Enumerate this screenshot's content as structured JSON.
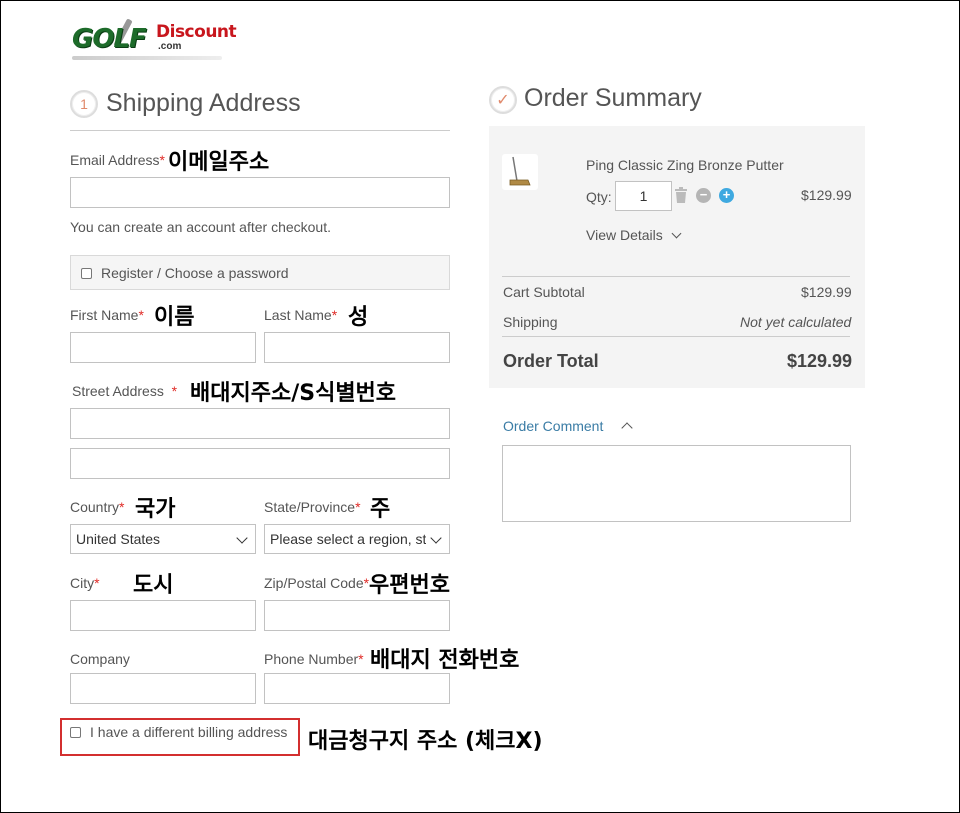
{
  "logo": {
    "golf": "GOLF",
    "discount": "Discount",
    "com": ".com"
  },
  "shipping": {
    "step_number": "1",
    "title": "Shipping Address",
    "email_label": "Email Address",
    "account_note": "You can create an account after checkout.",
    "register_label": "Register / Choose a password",
    "first_name_label": "First Name",
    "last_name_label": "Last Name",
    "street_label": "Street Address",
    "country_label": "Country",
    "country_value": "United States",
    "state_label": "State/Province",
    "state_value": "Please select a region, state or province.",
    "city_label": "City",
    "zip_label": "Zip/Postal Code",
    "company_label": "Company",
    "phone_label": "Phone Number",
    "billing_label": "I have a different billing address",
    "required_mark": "*"
  },
  "annotations": {
    "email": "이메일주소",
    "first_name": "이름",
    "last_name": "성",
    "street": "배대지주소/S식별번호",
    "country": "국가",
    "state": "주",
    "city": "도시",
    "zip": "우편번호",
    "phone": "배대지 전화번호",
    "billing": "대금청구지 주소 (체크X)"
  },
  "summary": {
    "check_icon": "✓",
    "title": "Order Summary",
    "product_name": "Ping Classic Zing Bronze Putter",
    "qty_label": "Qty:",
    "qty_value": "1",
    "item_price": "$129.99",
    "view_details": "View Details",
    "cart_subtotal_label": "Cart Subtotal",
    "cart_subtotal_value": "$129.99",
    "shipping_label": "Shipping",
    "shipping_value": "Not yet calculated",
    "order_total_label": "Order Total",
    "order_total_value": "$129.99",
    "order_comment_label": "Order Comment"
  },
  "colors": {
    "required": "#e02b27",
    "link": "#3a7ca5",
    "highlight_box": "#d32f2f",
    "minus_button": "#b5b5b5",
    "plus_button": "#3fa9e0"
  }
}
